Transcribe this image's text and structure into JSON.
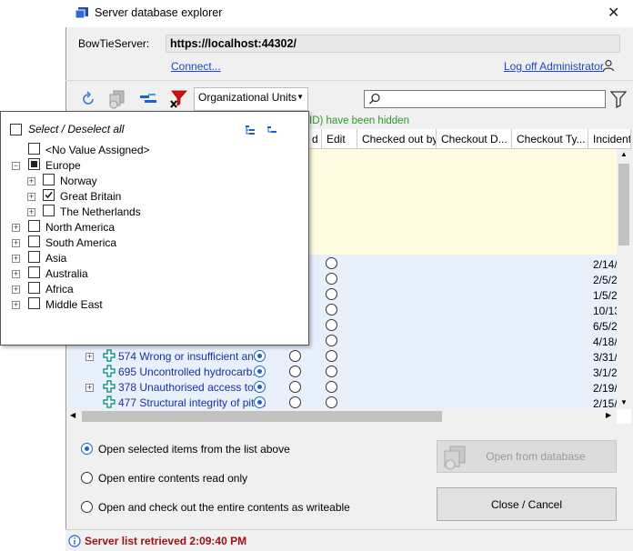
{
  "window": {
    "title": "Server database explorer",
    "close_glyph": "✕"
  },
  "server": {
    "label": "BowTieServer:",
    "url": "https://localhost:44302/",
    "connect_label": "Connect...",
    "logoff_label": "Log off Administrator"
  },
  "toolbar": {
    "dropdown_value": "Organizational Units",
    "search_placeholder": ""
  },
  "grid": {
    "hidden_notice": "ID) have been hidden",
    "columns": [
      "d",
      "Edit",
      "Checked out by",
      "Checkout D...",
      "Checkout Ty...",
      "Incident"
    ],
    "dates": [
      "2/14/",
      "2/5/2",
      "1/5/2",
      "10/13",
      "6/5/2",
      "4/18/",
      "3/31/",
      "3/1/2",
      "2/19/",
      "2/15/"
    ],
    "rows": [
      {
        "label": "574 Wrong or insufficient an...",
        "expandable": true
      },
      {
        "label": "695 Uncontrolled hydrocarb...",
        "expandable": false
      },
      {
        "label": "378 Unauthorised access to...",
        "expandable": true
      },
      {
        "label": "477 Structural integrity of pit ...",
        "expandable": false
      }
    ]
  },
  "filter_popup": {
    "select_all_label": "Select / Deselect all",
    "tree": [
      {
        "label": "<No Value Assigned>",
        "level": 1,
        "state": "unchecked",
        "expander": false
      },
      {
        "label": "Europe",
        "level": 0,
        "state": "partial",
        "expander": "minus"
      },
      {
        "label": "Norway",
        "level": 1,
        "state": "unchecked",
        "expander": "plus"
      },
      {
        "label": "Great Britain",
        "level": 1,
        "state": "checked",
        "expander": "plus"
      },
      {
        "label": "The Netherlands",
        "level": 1,
        "state": "unchecked",
        "expander": "plus"
      },
      {
        "label": "North America",
        "level": 0,
        "state": "unchecked",
        "expander": "plus"
      },
      {
        "label": "South America",
        "level": 0,
        "state": "unchecked",
        "expander": "plus"
      },
      {
        "label": "Asia",
        "level": 0,
        "state": "unchecked",
        "expander": "plus"
      },
      {
        "label": "Australia",
        "level": 0,
        "state": "unchecked",
        "expander": "plus"
      },
      {
        "label": "Africa",
        "level": 0,
        "state": "unchecked",
        "expander": "plus"
      },
      {
        "label": "Middle East",
        "level": 0,
        "state": "unchecked",
        "expander": "plus"
      }
    ]
  },
  "options": {
    "open_selected": "Open selected items from the list above",
    "open_readonly": "Open entire contents read only",
    "open_writeable": "Open and check out the entire contents as writeable",
    "selected_index": 0
  },
  "buttons": {
    "open_from_db": "Open from database",
    "close_cancel": "Close / Cancel"
  },
  "status": {
    "text": "Server list retrieved 2:09:40 PM",
    "color": "#a01010"
  },
  "colors": {
    "accent": "#1a64d0",
    "link": "#1a48c8",
    "notice_green": "#2a9a2a"
  }
}
